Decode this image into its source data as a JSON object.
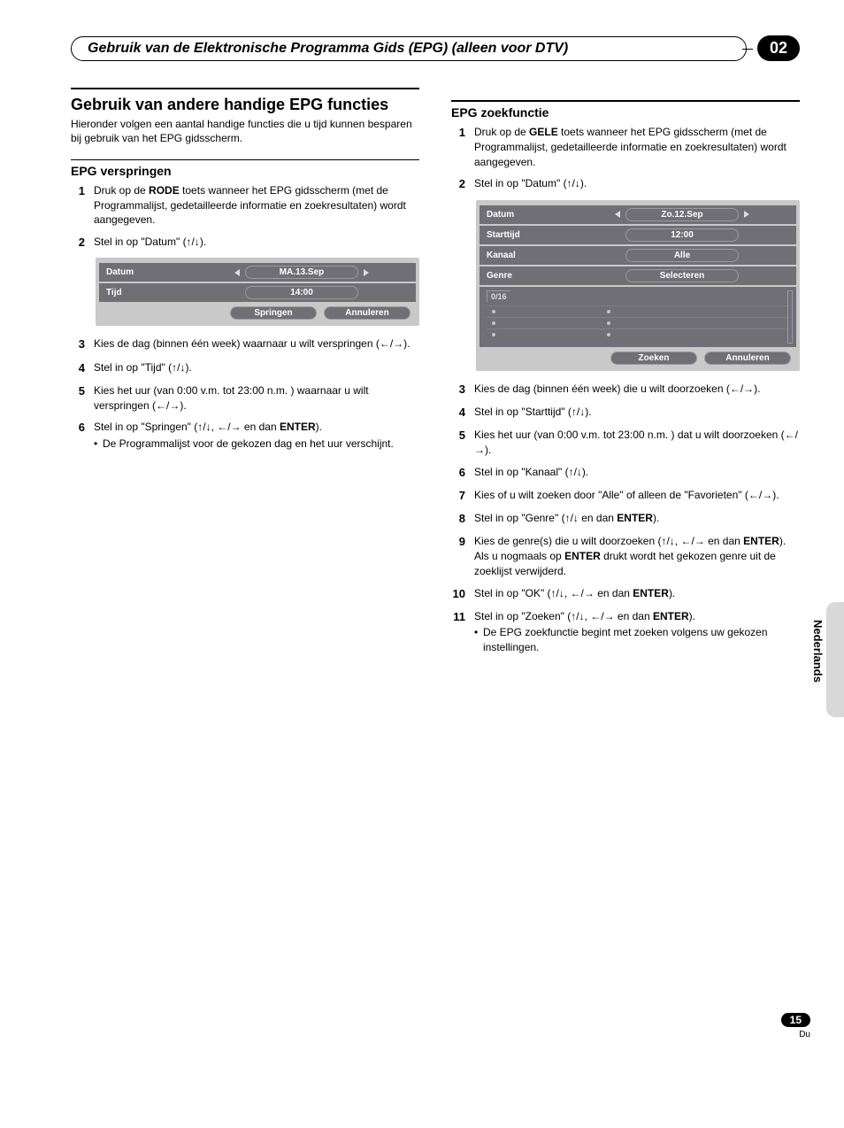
{
  "header": {
    "title": "Gebruik van de Elektronische Programma Gids (EPG) (alleen voor DTV)",
    "chapter": "02"
  },
  "left": {
    "h2": "Gebruik van andere handige EPG functies",
    "intro": "Hieronder volgen een aantal handige functies die u tijd kunnen besparen bij gebruik van het EPG gidsscherm.",
    "sub1": "EPG verspringen",
    "steps_a": [
      {
        "n": "1",
        "html": "Druk op de <b>RODE</b> toets wanneer het EPG gidsscherm (met de Programmalijst, gedetailleerde informatie en zoekresultaten) wordt aangegeven."
      },
      {
        "n": "2",
        "html": "Stel in op \"Datum\" (↑/↓)."
      }
    ],
    "panel1": {
      "rows": [
        {
          "label": "Datum",
          "value": "MA.13.Sep",
          "nav": true
        },
        {
          "label": "Tijd",
          "value": "14:00"
        }
      ],
      "buttons": [
        "Springen",
        "Annuleren"
      ]
    },
    "steps_b": [
      {
        "n": "3",
        "html": "Kies de dag (binnen één week) waarnaar u wilt verspringen (←/→)."
      },
      {
        "n": "4",
        "html": "Stel in op \"Tijd\"  (↑/↓)."
      },
      {
        "n": "5",
        "html": "Kies het uur (van 0:00 v.m. tot 23:00 n.m. ) waarnaar u wilt verspringen (←/→)."
      },
      {
        "n": "6",
        "html": "Stel in op \"Springen\" (↑/↓, ←/→ en dan <b>ENTER</b>).",
        "bullet": "De Programmalijst voor de gekozen dag en het uur verschijnt."
      }
    ]
  },
  "right": {
    "sub1": "EPG zoekfunctie",
    "steps_a": [
      {
        "n": "1",
        "html": "Druk op de <b>GELE</b> toets wanneer het EPG gidsscherm (met de Programmalijst, gedetailleerde informatie en zoekresultaten) wordt aangegeven."
      },
      {
        "n": "2",
        "html": "Stel in op \"Datum\" (↑/↓)."
      }
    ],
    "panel2": {
      "rows": [
        {
          "label": "Datum",
          "value": "Zo.12.Sep",
          "nav": true
        },
        {
          "label": "Starttijd",
          "value": "12:00"
        },
        {
          "label": "Kanaal",
          "value": "Alle"
        },
        {
          "label": "Genre",
          "value": "Selecteren"
        }
      ],
      "count": "0/16",
      "buttons": [
        "Zoeken",
        "Annuleren"
      ]
    },
    "steps_b": [
      {
        "n": "3",
        "html": "Kies de dag (binnen één week) die u wilt doorzoeken (←/→)."
      },
      {
        "n": "4",
        "html": "Stel in op \"Starttijd\" (↑/↓)."
      },
      {
        "n": "5",
        "html": "Kies het uur (van 0:00 v.m. tot 23:00 n.m. ) dat u wilt doorzoeken (←/→)."
      },
      {
        "n": "6",
        "html": "Stel in op \"Kanaal\" (↑/↓)."
      },
      {
        "n": "7",
        "html": "Kies of u wilt zoeken door \"Alle\" of alleen de \"Favorieten\" (←/→)."
      },
      {
        "n": "8",
        "html": "Stel in op \"Genre\" (↑/↓ en dan <b>ENTER</b>)."
      },
      {
        "n": "9",
        "html": "Kies de genre(s) die u wilt doorzoeken (↑/↓, ←/→ en dan <b>ENTER</b>). Als u nogmaals op <b>ENTER</b> drukt wordt het gekozen genre uit de zoeklijst verwijderd."
      },
      {
        "n": "10",
        "html": "Stel in op \"OK\" (↑/↓, ←/→ en dan <b>ENTER</b>)."
      },
      {
        "n": "11",
        "html": "Stel in op \"Zoeken\" (↑/↓, ←/→ en dan <b>ENTER</b>).",
        "bullet": "De EPG zoekfunctie begint met zoeken volgens uw gekozen instellingen."
      }
    ]
  },
  "side": {
    "language": "Nederlands"
  },
  "footer": {
    "page": "15",
    "lang": "Du"
  }
}
